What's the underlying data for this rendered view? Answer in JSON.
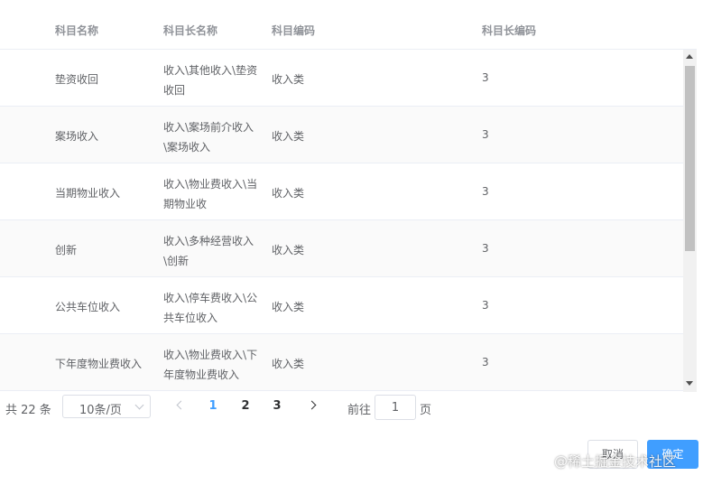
{
  "table": {
    "headers": [
      "科目名称",
      "科目长名称",
      "科目编码",
      "科目长编码"
    ],
    "rows": [
      {
        "name": "垫资收回",
        "long_name": "收入\\其他收入\\垫资收回",
        "code": "收入类",
        "long_code": "3"
      },
      {
        "name": "案场收入",
        "long_name": "收入\\案场前介收入\\案场收入",
        "code": "收入类",
        "long_code": "3"
      },
      {
        "name": "当期物业收入",
        "long_name": "收入\\物业费收入\\当期物业收",
        "code": "收入类",
        "long_code": "3"
      },
      {
        "name": "创新",
        "long_name": "收入\\多种经营收入\\创新",
        "code": "收入类",
        "long_code": "3"
      },
      {
        "name": "公共车位收入",
        "long_name": "收入\\停车费收入\\公共车位收入",
        "code": "收入类",
        "long_code": "3"
      },
      {
        "name": "下年度物业费收入",
        "long_name": "收入\\物业费收入\\下年度物业费收入",
        "code": "收入类",
        "long_code": "3"
      }
    ]
  },
  "pagination": {
    "total_label": "共 22 条",
    "page_size": "10条/页",
    "pages": [
      "1",
      "2",
      "3"
    ],
    "current_page": "1",
    "goto_label": "前往",
    "jump_value": "1",
    "page_suffix": "页"
  },
  "footer": {
    "cancel_label": "取消",
    "confirm_label": "确定"
  },
  "watermark": "@稀土掘金技术社区",
  "colors": {
    "accent": "#409eff",
    "border": "#ebeef5",
    "header_text": "#909399",
    "body_text": "#606266"
  }
}
